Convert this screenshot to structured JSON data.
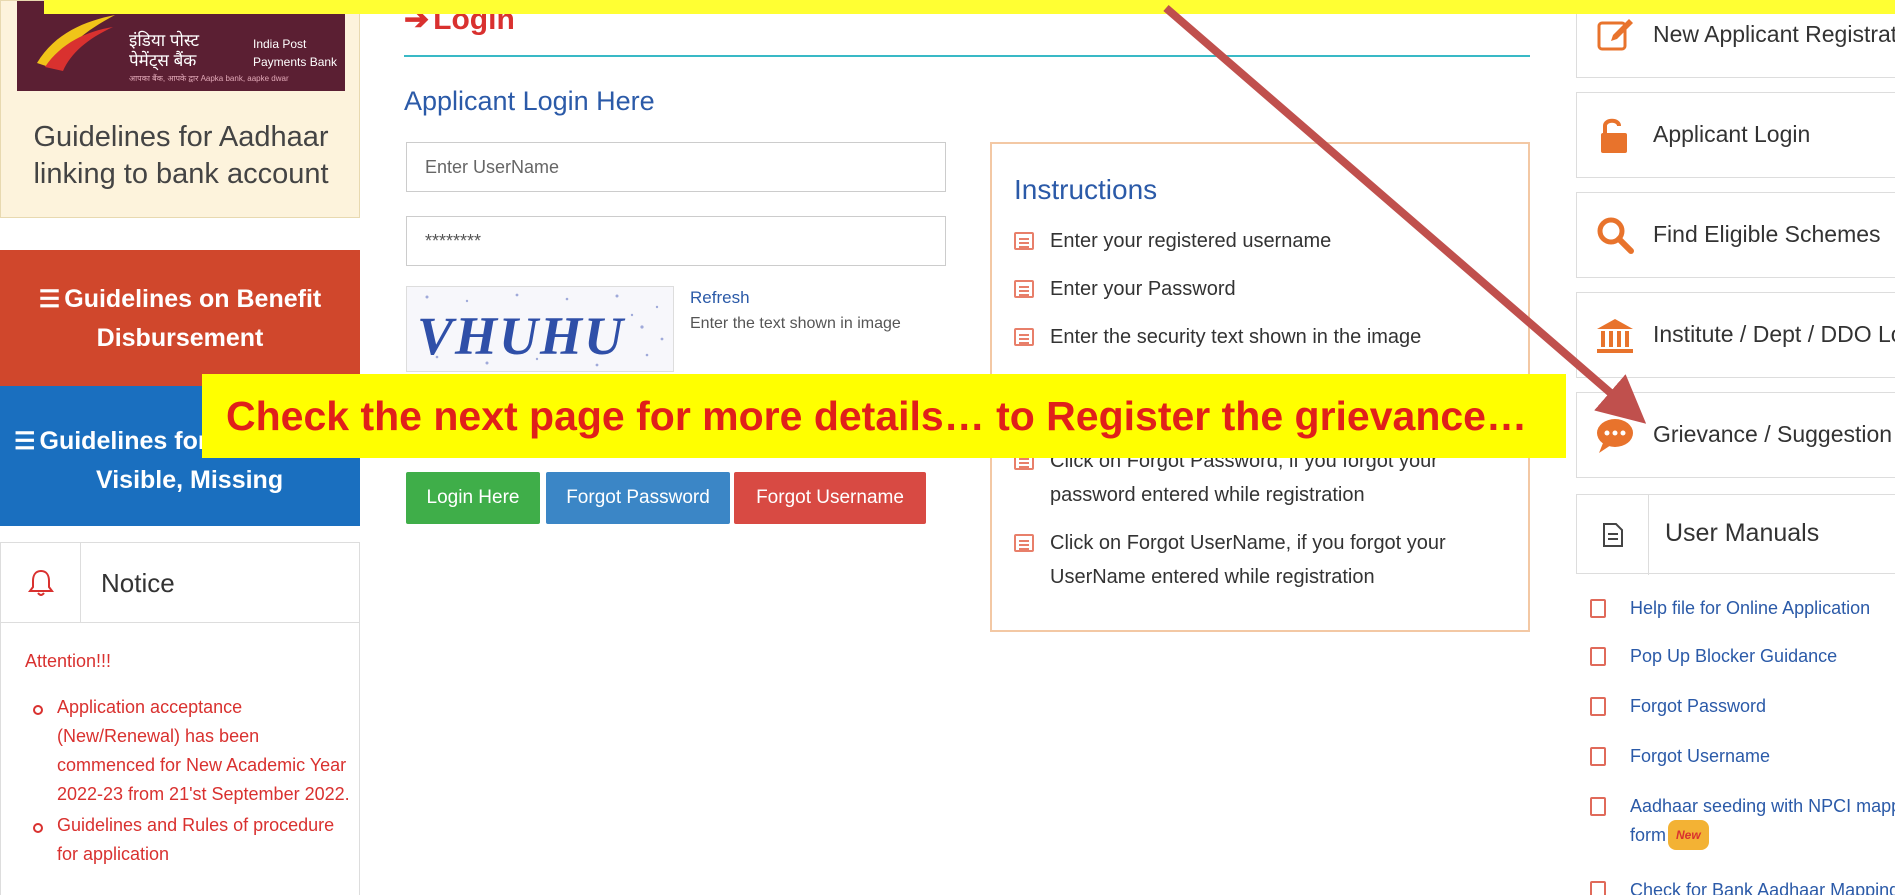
{
  "ippb": {
    "hindi_line1": "इंडिया पोस्ट",
    "hindi_line2": "पेमेंट्स बैंक",
    "eng_line1": "India Post",
    "eng_line2": "Payments Bank",
    "tagline": "आपका बैंक, आपके द्वार   Aapka bank, aapke dwar",
    "title": "Guidelines for Aadhaar linking to bank account"
  },
  "left": {
    "benefit_label": "Guidelines on Benefit Disbursement",
    "visible_line1": "Guidelines for",
    "visible_line2": "Visible, Missing"
  },
  "notice": {
    "title": "Notice",
    "attention": "Attention!!!",
    "items": [
      "Application acceptance (New/Renewal) has been commenced for New Academic Year 2022-23 from 21'st September 2022.",
      "Guidelines and Rules of procedure for application"
    ]
  },
  "login": {
    "heading": "Login",
    "subheading": "Applicant Login Here",
    "username_placeholder": "Enter UserName",
    "password_value": "********",
    "captcha_text": "VHUHU",
    "refresh_label": "Refresh",
    "captcha_hint": "Enter the text shown in image",
    "login_btn": "Login Here",
    "forgot_password_btn": "Forgot Password",
    "forgot_username_btn": "Forgot Username"
  },
  "instructions": {
    "title": "Instructions",
    "items": [
      "Enter your registered username",
      "Enter your Password",
      "Enter the security text shown in the image",
      "Click on Forgot Password, if you forgot your password entered while registration",
      "Click on Forgot UserName, if you forgot your UserName entered while registration"
    ]
  },
  "right": {
    "cards": [
      {
        "label": "New Applicant Registration",
        "icon": "edit-icon"
      },
      {
        "label": "Applicant Login",
        "icon": "unlock-icon"
      },
      {
        "label": "Find Eligible Schemes",
        "icon": "search-icon"
      },
      {
        "label": "Institute / Dept / DDO Login",
        "icon": "institution-icon"
      },
      {
        "label": "Grievance / Suggestion",
        "icon": "chat-icon"
      }
    ],
    "manuals_title": "User Manuals",
    "manuals": [
      "Help file for Online Application",
      "Pop Up Blocker Guidance",
      "Forgot Password",
      "Forgot Username",
      "Aadhaar seeding with NPCI mapper",
      "form",
      "Check for Bank Aadhaar Mapping"
    ],
    "new_badge": "New"
  },
  "overlay": {
    "callout_text": "Check the next page for more details… to Register the grievance…"
  },
  "colors": {
    "callout_bg": "#ffff00",
    "callout_text": "#e0201a",
    "arrow": "#c0504d",
    "benefit": "#d0472c",
    "visible": "#1a6fbf",
    "login_green": "#3fae49",
    "forgot_blue": "#3b86c6",
    "forgot_red": "#d84a43"
  }
}
